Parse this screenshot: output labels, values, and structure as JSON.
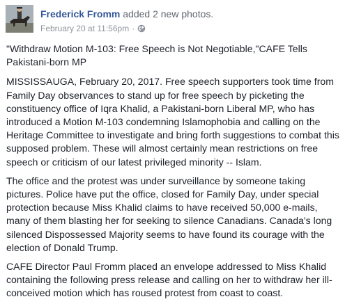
{
  "post": {
    "author": "Frederick Fromm",
    "action": "added 2 new photos.",
    "timestamp": "February 20 at 11:56pm",
    "separator": "·",
    "privacy_icon": "globe-icon",
    "colors": {
      "author_link": "#365899",
      "meta_text": "#90949c",
      "body_text": "#1d2129"
    },
    "paragraphs": [
      "\"Withdraw Motion M-103: Free Speech is Not Negotiable,\"CAFE Tells Pakistani-born MP",
      "MISSISSAUGA, February 20, 2017. Free speech supporters took time from Family Day observances to stand up for free speech by picketing the constituency office of Iqra Khalid, a Pakistani-born Liberal MP, who has introduced a Motion M-103 condemning Islamophobia and calling on the Heritage Committee to investigate and bring forth suggestions to combat this supposed problem. These will almost certainly mean restrictions on free speech or criticism of our latest privileged minority -- Islam.",
      "The office and the protest was under surveillance by someone taking pictures. Police have put the office, closed for Family Day, under special protection because Miss Khalid claims to have received 50,000 e-mails, many of them blasting her for seeking to silence Canadians. Canada's long silenced Dispossessed Majority seems to have found its courage with the election of Donald Trump.",
      "CAFE Director Paul Fromm placed an envelope addressed to Miss Khalid containing the following press release and calling on her to withdraw her ill-conceived motion which has roused protest from coast to coast."
    ]
  }
}
